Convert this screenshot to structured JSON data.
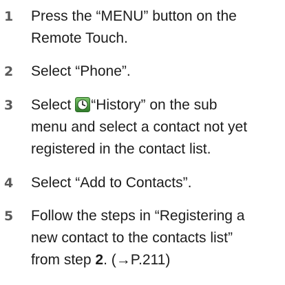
{
  "steps": [
    {
      "number": "1",
      "lines": [
        "Press the “MENU” button on the",
        "Remote Touch."
      ]
    },
    {
      "number": "2",
      "lines": [
        "Select “Phone”."
      ]
    },
    {
      "number": "3",
      "line1_prefix": "Select",
      "line1_suffix": "“History” on the sub",
      "lines_rest": [
        "menu and select a contact not yet",
        "registered in the contact list."
      ],
      "icon": "history-clock-icon"
    },
    {
      "number": "4",
      "lines": [
        "Select “Add to Contacts”."
      ]
    },
    {
      "number": "5",
      "lines": [
        "Follow the steps in “Registering a",
        "new contact to the contacts list”"
      ],
      "last_line_prefix": "from step",
      "last_line_step": "2",
      "last_line_suffix": ". (→P.211)"
    }
  ],
  "colors": {
    "number": "#5a5a5a",
    "text": "#1c1c1c",
    "icon_fill": "#4c9a3e"
  }
}
